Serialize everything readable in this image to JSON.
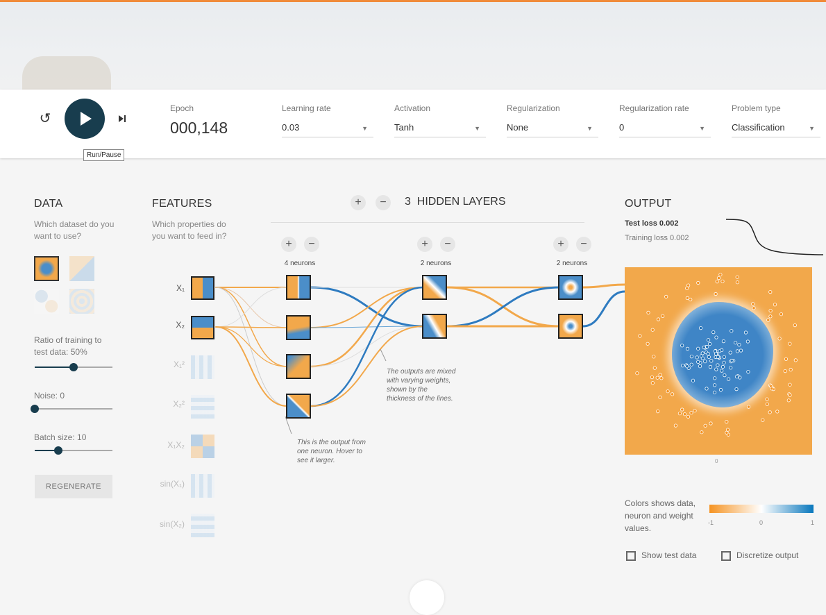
{
  "controls": {
    "reset_icon": "reset-icon",
    "play_icon": "play-icon",
    "step_icon": "step-icon",
    "tooltip": "Run/Pause",
    "epoch_label": "Epoch",
    "epoch_value": "000,148",
    "learning_rate": {
      "label": "Learning rate",
      "value": "0.03"
    },
    "activation": {
      "label": "Activation",
      "value": "Tanh"
    },
    "regularization": {
      "label": "Regularization",
      "value": "None"
    },
    "regularization_rate": {
      "label": "Regularization rate",
      "value": "0"
    },
    "problem_type": {
      "label": "Problem type",
      "value": "Classification"
    }
  },
  "data": {
    "title": "DATA",
    "subtitle": "Which dataset do you want to use?",
    "ratio_label": "Ratio of training to test data:",
    "ratio_value": "50%",
    "ratio_fraction": 0.5,
    "noise_label": "Noise:",
    "noise_value": "0",
    "noise_fraction": 0.0,
    "batch_label": "Batch size:",
    "batch_value": "10",
    "batch_fraction": 0.3,
    "regenerate": "REGENERATE"
  },
  "features": {
    "title": "FEATURES",
    "subtitle": "Which properties do you want to feed in?",
    "items": [
      {
        "label": "X₁",
        "active": true
      },
      {
        "label": "X₂",
        "active": true
      },
      {
        "label": "X₁²",
        "active": false
      },
      {
        "label": "X₂²",
        "active": false
      },
      {
        "label": "X₁X₂",
        "active": false
      },
      {
        "label": "sin(X₁)",
        "active": false
      },
      {
        "label": "sin(X₂)",
        "active": false
      }
    ]
  },
  "network": {
    "hidden_layers_count": "3",
    "hidden_layers_label": "HIDDEN LAYERS",
    "layers": [
      {
        "neurons_label": "4 neurons"
      },
      {
        "neurons_label": "2 neurons"
      },
      {
        "neurons_label": "2 neurons"
      }
    ],
    "note_weights": "The outputs are mixed with varying weights, shown by the thickness of the lines.",
    "note_output": "This is the output from one neuron. Hover to see it larger."
  },
  "output": {
    "title": "OUTPUT",
    "test_loss": "Test loss 0.002",
    "training_loss": "Training loss 0.002",
    "legend_text": "Colors shows data, neuron and weight values.",
    "legend_min": "-1",
    "legend_mid": "0",
    "legend_max": "1",
    "axis_zero": "0",
    "show_test_data": "Show test data",
    "discretize_output": "Discretize output"
  },
  "colors": {
    "accent": "#183d4e",
    "orange": "#f59322",
    "blue": "#0877bd",
    "top_bar": "#f08a3a"
  }
}
